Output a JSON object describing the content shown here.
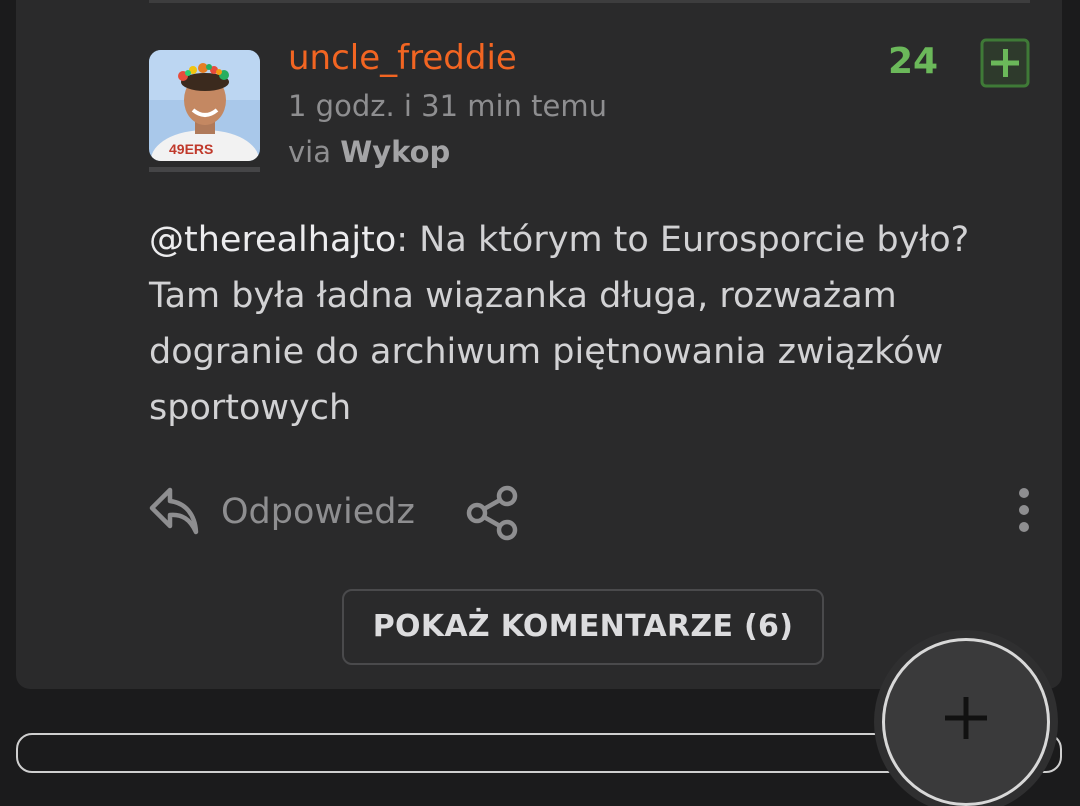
{
  "entry": {
    "username": "uncle_freddie",
    "time_ago": "1 godz. i 31 min temu",
    "via_prefix": "via",
    "via_source": "Wykop",
    "score": "24",
    "mention": "@therealhajto",
    "body": ": Na którym to Eurosporcie było? Tam była ładna wiązanka długa, rozważam dogranie do archiwum piętnowania związków sportowych"
  },
  "actions": {
    "reply_label": "Odpowiedz",
    "show_comments_label": "POKAŻ KOMENTARZE (6)"
  },
  "icons": {
    "upvote": "plus-square-icon",
    "reply": "reply-arrow-icon",
    "share": "share-icon",
    "more": "more-vertical-icon",
    "fab": "plus-icon"
  },
  "colors": {
    "username": "#f26522",
    "score": "#6bb85a",
    "upvote_border": "#3f7a37",
    "card_bg": "#2a2a2b",
    "page_bg": "#1b1b1c"
  }
}
